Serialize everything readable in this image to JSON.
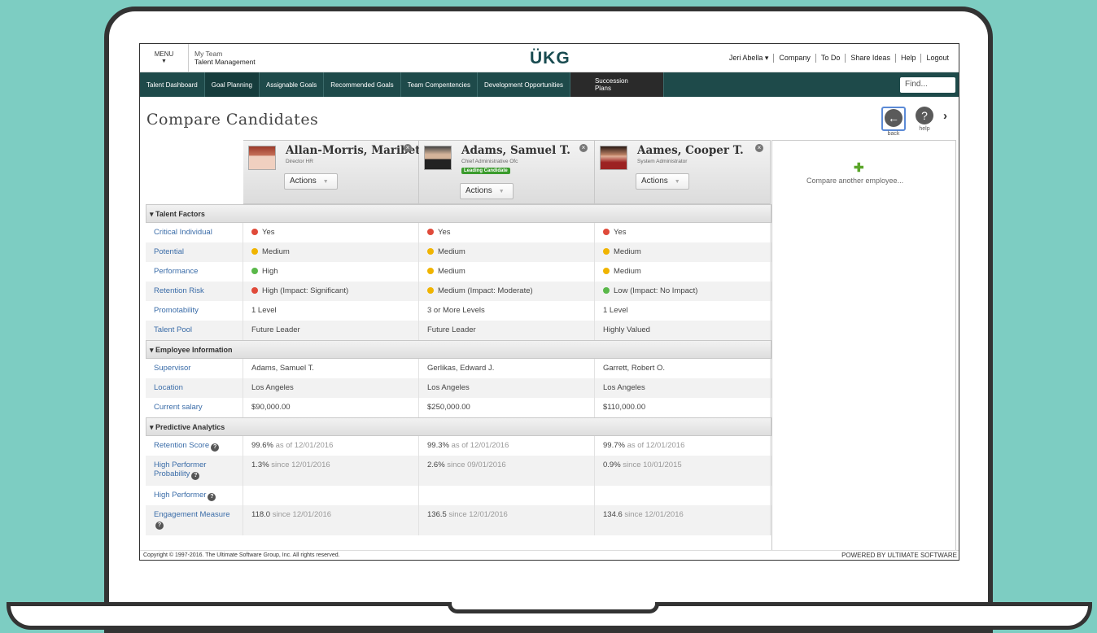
{
  "colors": {
    "brand": "#1e4a4a",
    "red": "#e04a3a",
    "yellow": "#f0b400",
    "green": "#5ab84a",
    "link": "#3a6ca8"
  },
  "topbar": {
    "menu_label": "MENU",
    "team_line1": "My Team",
    "team_line2": "Talent Management",
    "logo": "ÜKG",
    "links": [
      "Jeri Abella ▾",
      "Company",
      "To Do",
      "Share Ideas",
      "Help",
      "Logout"
    ]
  },
  "nav": {
    "tabs": [
      "Talent Dashboard",
      "Goal Planning",
      "Assignable Goals",
      "Recommended Goals",
      "Team Compentencies",
      "Development Opportunities"
    ],
    "succession": "Succession Plans",
    "find_placeholder": "Find..."
  },
  "page": {
    "title": "Compare Candidates",
    "back_label": "back",
    "help_label": "help"
  },
  "candidates": [
    {
      "name": "Allan-Morris, Maribeth",
      "title": "Director HR",
      "badge": "",
      "actions": "Actions"
    },
    {
      "name": "Adams, Samuel T.",
      "title": "Chief Administrative Ofc",
      "badge": "Leading Candidate",
      "actions": "Actions"
    },
    {
      "name": "Aames, Cooper T.",
      "title": "System Administrator",
      "badge": "",
      "actions": "Actions"
    }
  ],
  "compare_another": "Compare another employee...",
  "sections": [
    {
      "title": "▾ Talent Factors",
      "rows": [
        {
          "label": "Critical Individual",
          "values": [
            {
              "t": "Yes",
              "dot": "red"
            },
            {
              "t": "Yes",
              "dot": "red"
            },
            {
              "t": "Yes",
              "dot": "red"
            }
          ]
        },
        {
          "label": "Potential",
          "values": [
            {
              "t": "Medium",
              "dot": "yellow"
            },
            {
              "t": "Medium",
              "dot": "yellow"
            },
            {
              "t": "Medium",
              "dot": "yellow"
            }
          ]
        },
        {
          "label": "Performance",
          "values": [
            {
              "t": "High",
              "dot": "green"
            },
            {
              "t": "Medium",
              "dot": "yellow"
            },
            {
              "t": "Medium",
              "dot": "yellow"
            }
          ]
        },
        {
          "label": "Retention Risk",
          "values": [
            {
              "t": "High (Impact: Significant)",
              "dot": "red"
            },
            {
              "t": "Medium (Impact: Moderate)",
              "dot": "yellow"
            },
            {
              "t": "Low (Impact: No Impact)",
              "dot": "green"
            }
          ]
        },
        {
          "label": "Promotability",
          "values": [
            {
              "t": "1 Level"
            },
            {
              "t": "3 or More Levels"
            },
            {
              "t": "1 Level"
            }
          ]
        },
        {
          "label": "Talent Pool",
          "values": [
            {
              "t": "Future Leader"
            },
            {
              "t": "Future Leader"
            },
            {
              "t": "Highly Valued"
            }
          ]
        }
      ]
    },
    {
      "title": "▾ Employee Information",
      "rows": [
        {
          "label": "Supervisor",
          "values": [
            {
              "t": "Adams, Samuel T."
            },
            {
              "t": "Gerlikas, Edward J."
            },
            {
              "t": "Garrett, Robert O."
            }
          ]
        },
        {
          "label": "Location",
          "values": [
            {
              "t": "Los Angeles"
            },
            {
              "t": "Los Angeles"
            },
            {
              "t": "Los Angeles"
            }
          ]
        },
        {
          "label": "Current salary",
          "values": [
            {
              "t": "$90,000.00"
            },
            {
              "t": "$250,000.00"
            },
            {
              "t": "$110,000.00"
            }
          ]
        }
      ]
    },
    {
      "title": "▾ Predictive Analytics",
      "rows": [
        {
          "label": "Retention Score",
          "help": true,
          "values": [
            {
              "t": "99.6%",
              "s": " as of 12/01/2016"
            },
            {
              "t": "99.3%",
              "s": " as of 12/01/2016"
            },
            {
              "t": "99.7%",
              "s": " as of 12/01/2016"
            }
          ]
        },
        {
          "label": "High Performer Probability",
          "help": true,
          "tall": true,
          "values": [
            {
              "t": "1.3%",
              "s": " since 12/01/2016"
            },
            {
              "t": "2.6%",
              "s": " since 09/01/2016"
            },
            {
              "t": "0.9%",
              "s": " since 10/01/2015"
            }
          ]
        },
        {
          "label": "High Performer",
          "help": true,
          "values": [
            {
              "t": ""
            },
            {
              "t": ""
            },
            {
              "t": ""
            }
          ]
        },
        {
          "label": "Engagement Measure",
          "help": true,
          "tall": true,
          "values": [
            {
              "t": "118.0",
              "s": " since 12/01/2016"
            },
            {
              "t": "136.5",
              "s": " since 12/01/2016"
            },
            {
              "t": "134.6",
              "s": " since 12/01/2016"
            }
          ]
        }
      ]
    }
  ],
  "footer": {
    "copyright": "Copyright © 1997-2016. The Ultimate Software Group, Inc. All rights reserved.",
    "powered": "POWERED BY ULTIMATE SOFTWARE"
  }
}
